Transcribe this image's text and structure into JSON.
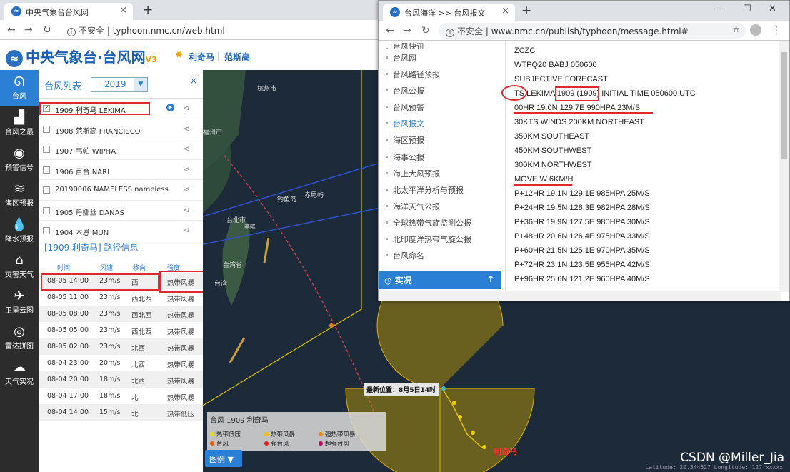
{
  "win1": {
    "tab_title": "中央气象台台风网",
    "url_warning": "不安全",
    "url": "typhoon.nmc.cn/web.html"
  },
  "site": {
    "logo": "中央气象台·台风网",
    "version": "V3",
    "active_typhoons": [
      "利奇马",
      "范斯高"
    ]
  },
  "leftbar": [
    {
      "icon": "typhoon-icon",
      "label": "台风"
    },
    {
      "icon": "bar-chart-icon",
      "label": "台风之最"
    },
    {
      "icon": "signal-icon",
      "label": "预警信号"
    },
    {
      "icon": "wave-icon",
      "label": "海区预报"
    },
    {
      "icon": "rain-icon",
      "label": "降水预报"
    },
    {
      "icon": "house-icon",
      "label": "灾害天气"
    },
    {
      "icon": "satellite-icon",
      "label": "卫星云图"
    },
    {
      "icon": "radar-icon",
      "label": "雷达拼图"
    },
    {
      "icon": "cloud-icon",
      "label": "天气实况"
    }
  ],
  "panel": {
    "title": "台风列表",
    "year": "2019",
    "close": "×",
    "typhoons": [
      {
        "name": "1909 利奇马 LEKIMA",
        "checked": true
      },
      {
        "name": "1908 范斯高 FRANCISCO",
        "checked": false
      },
      {
        "name": "1907 韦帕 WIPHA",
        "checked": false
      },
      {
        "name": "1906 百合 NARI",
        "checked": false
      },
      {
        "name": "20190006 NAMELESS nameless",
        "checked": false
      },
      {
        "name": "1905 丹娜丝 DANAS",
        "checked": false
      },
      {
        "name": "1904 木恩 MUN",
        "checked": false
      }
    ],
    "path_title": "[1909 利奇马] 路径信息",
    "columns": [
      "时间",
      "风速",
      "移向",
      "强度"
    ],
    "rows": [
      [
        "08-05 14:00",
        "23m/s",
        "西",
        "热带风暴"
      ],
      [
        "08-05 11:00",
        "23m/s",
        "西北西",
        "热带风暴"
      ],
      [
        "08-05 08:00",
        "23m/s",
        "西北西",
        "热带风暴"
      ],
      [
        "08-05 05:00",
        "23m/s",
        "西北西",
        "热带风暴"
      ],
      [
        "08-05 02:00",
        "23m/s",
        "北西",
        "热带风暴"
      ],
      [
        "08-04 23:00",
        "20m/s",
        "北西",
        "热带风暴"
      ],
      [
        "08-04 20:00",
        "18m/s",
        "北西",
        "热带风暴"
      ],
      [
        "08-04 17:00",
        "18m/s",
        "北",
        "热带风暴"
      ],
      [
        "08-04 14:00",
        "15m/s",
        "北",
        "热带低压"
      ]
    ]
  },
  "map": {
    "labels": [
      "台北市",
      "台湾省",
      "钓鱼岛",
      "赤尾屿",
      "台北市",
      "杭州市",
      "福州市",
      "台湾",
      "基隆"
    ],
    "latest": "最新位置：8月5日14时",
    "typhoon_label": "利奇马",
    "coord": "Latitude: 20.344627 Longitude: 127.xxxxx",
    "watermark": "CSDN @Miller_Jia"
  },
  "legend": {
    "title": "台风  1909 利奇马",
    "items": [
      {
        "label": "热带低压",
        "color": "#e8e000"
      },
      {
        "label": "热带风暴",
        "color": "#f0c000"
      },
      {
        "label": "强热带风暴",
        "color": "#f09000"
      },
      {
        "label": "台风",
        "color": "#f06000"
      },
      {
        "label": "强台风",
        "color": "#e02020"
      },
      {
        "label": "超强台风",
        "color": "#c00060"
      }
    ],
    "button": "图例"
  },
  "win2": {
    "tab_title": "台风海洋 >> 台风报文",
    "url_warning": "不安全",
    "url": "www.nmc.cn/publish/typhoon/message.html#",
    "menu": [
      "台风快讯",
      "台风网",
      "台风路径预报",
      "台风公报",
      "台风预警",
      "台风报文",
      "海区预报",
      "海事公报",
      "海上大风预报",
      "北太平洋分析与预报",
      "海洋天气公报",
      "全球热带气旋监测公报",
      "北印度洋热带气旋公报",
      "台风命名"
    ],
    "active_menu": "台风报文",
    "shikuang": "实况",
    "message": [
      "ZCZC",
      "WTPQ20 BABJ 050600",
      "SUBJECTIVE FORECAST",
      "TS LEKIMA 1909 (1909) INITIAL TIME 050600 UTC",
      "00HR 19.0N 129.7E 990HPA 23M/S",
      "30KTS WINDS 200KM NORTHEAST",
      "350KM SOUTHEAST",
      "450KM SOUTHWEST",
      "300KM NORTHWEST",
      "MOVE W 6KM/H",
      "P+12HR 19.1N 129.1E 985HPA 25M/S",
      "P+24HR 19.5N 128.3E 982HPA 28M/S",
      "P+36HR 19.9N 127.5E 980HPA 30M/S",
      "P+48HR 20.6N 126.4E 975HPA 33M/S",
      "P+60HR 21.5N 125.1E 970HPA 35M/S",
      "P+72HR 23.1N 123.5E 955HPA 42M/S",
      "P+96HR 25.6N 121.2E 960HPA 40M/S"
    ]
  }
}
